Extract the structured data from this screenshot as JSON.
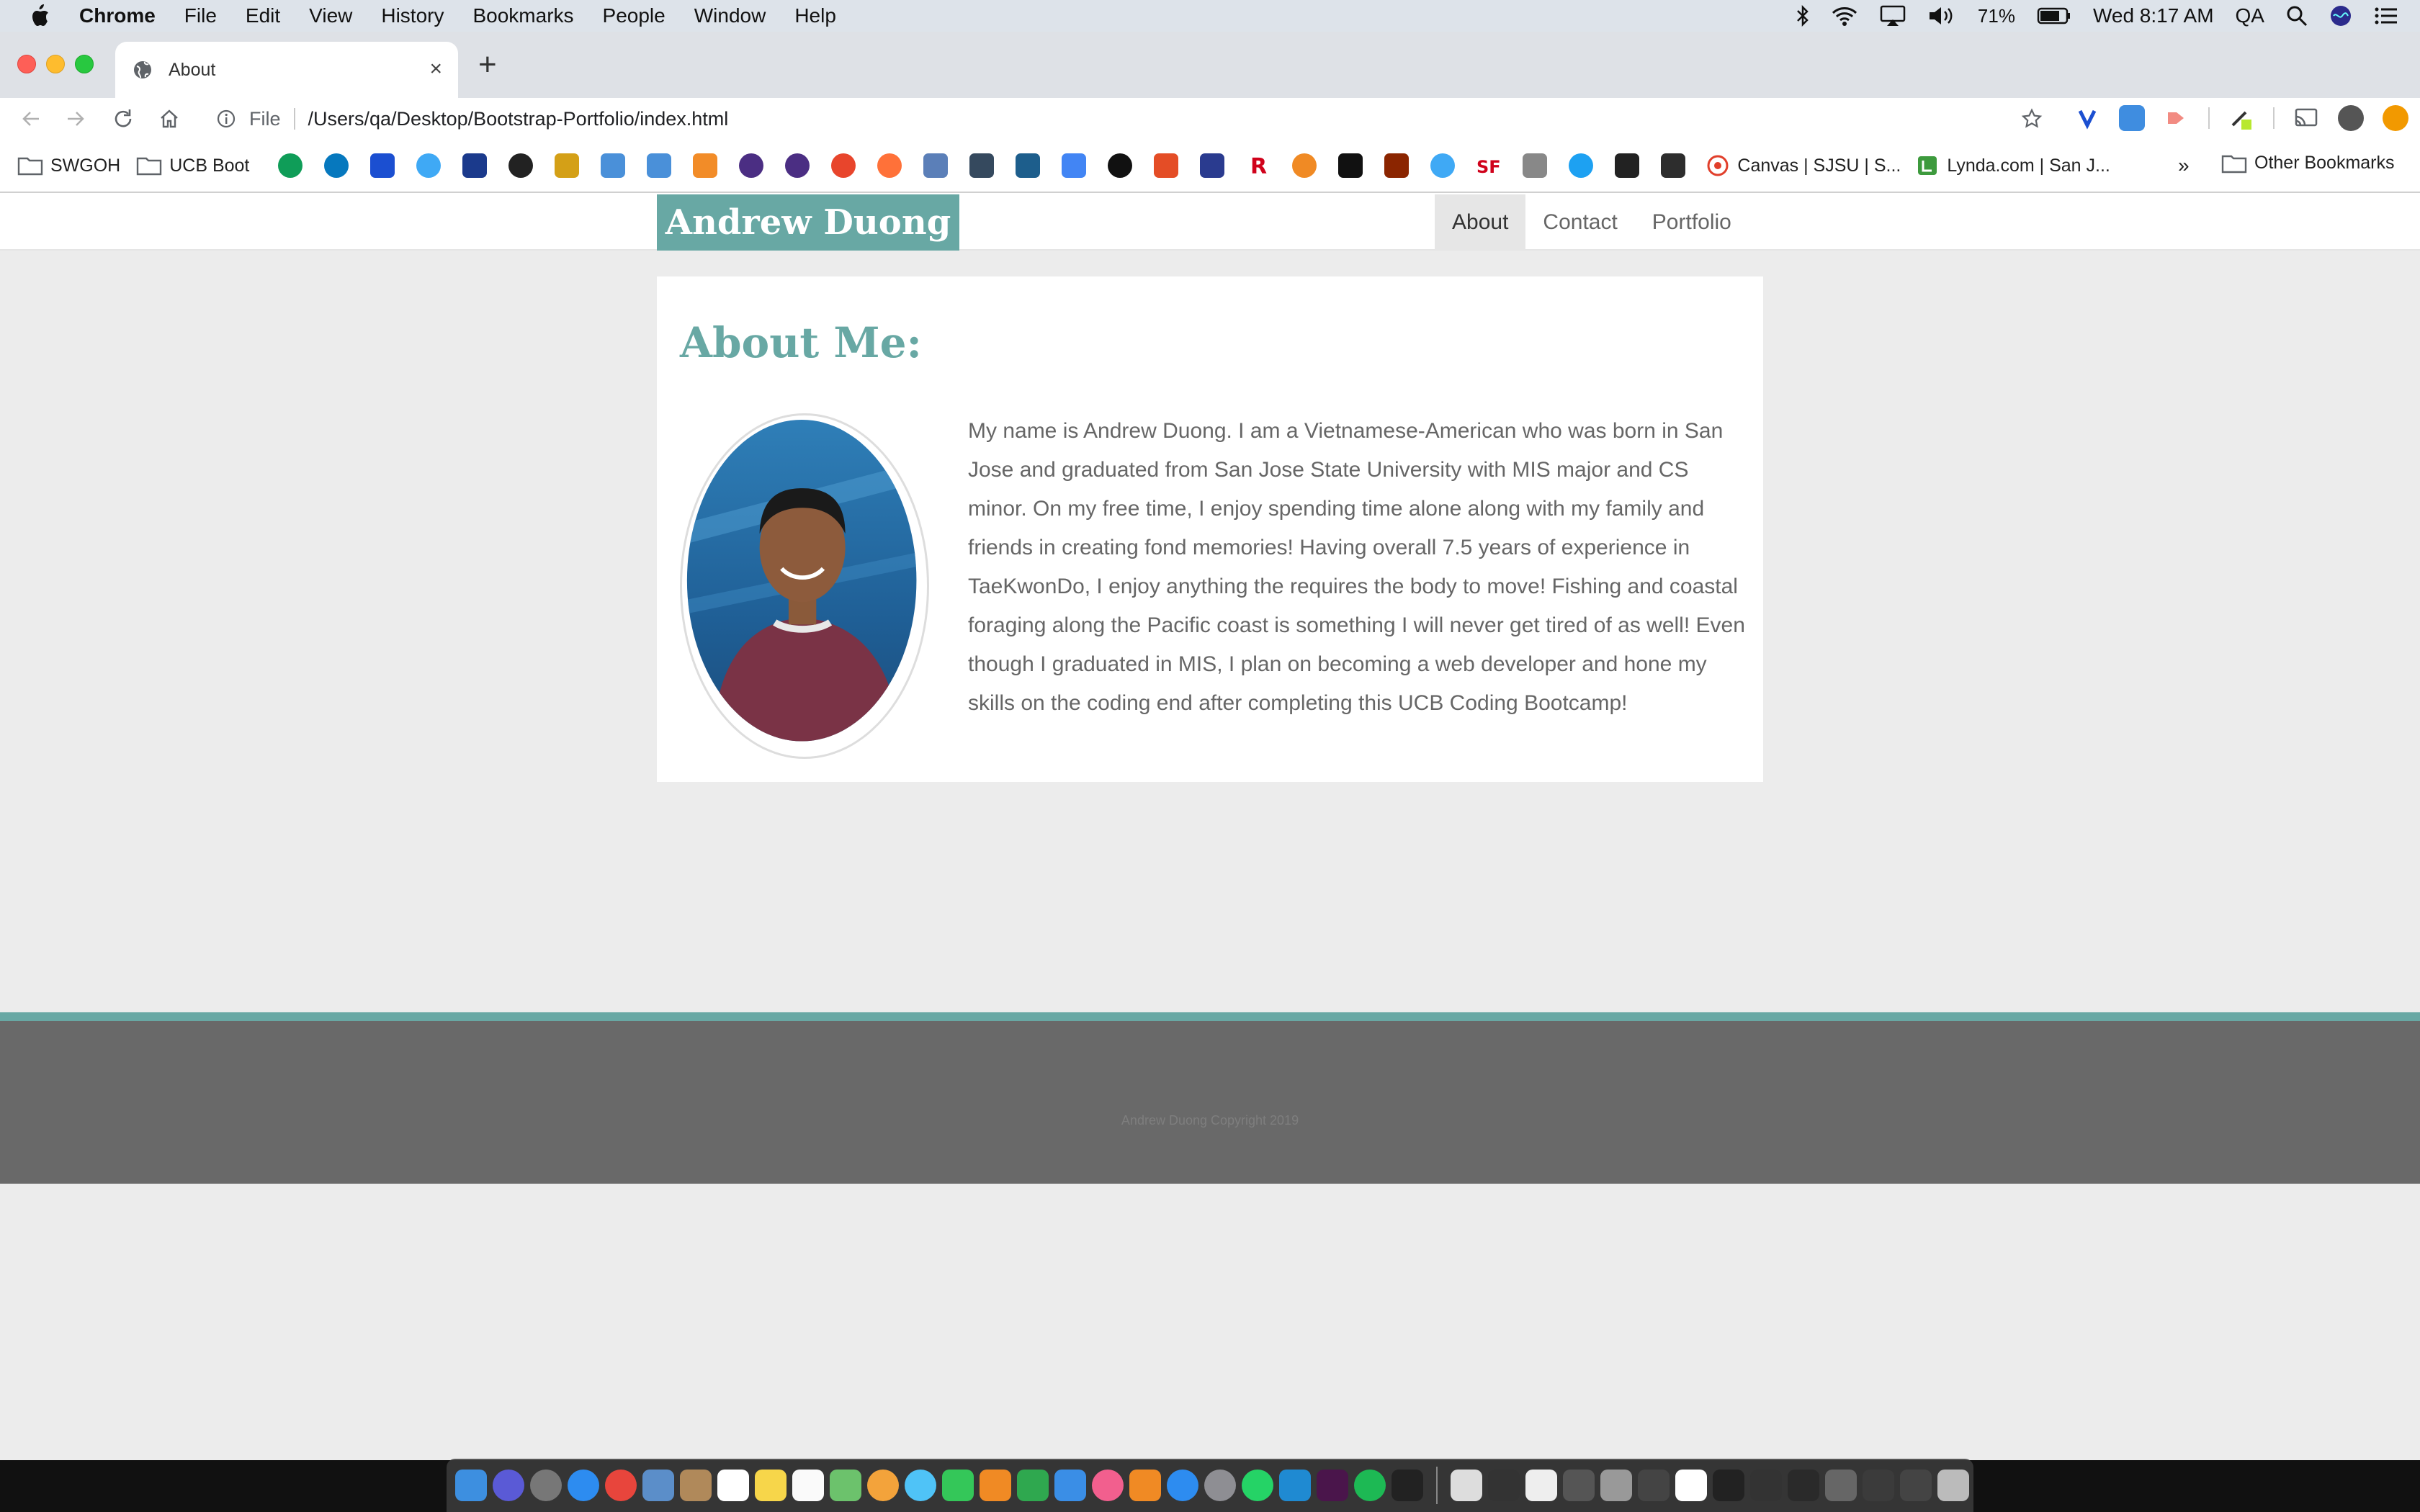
{
  "menubar": {
    "items": [
      "Chrome",
      "File",
      "Edit",
      "View",
      "History",
      "Bookmarks",
      "People",
      "Window",
      "Help"
    ],
    "battery": "71%",
    "clock": "Wed 8:17 AM",
    "user": "QA"
  },
  "tab": {
    "title": "About"
  },
  "addressbar": {
    "scheme": "File",
    "url": "/Users/qa/Desktop/Bootstrap-Portfolio/index.html"
  },
  "bookmarks": {
    "folders": [
      "SWGOH",
      "UCB Boot"
    ],
    "named": [
      "Canvas | SJSU | S...",
      "Lynda.com | San J..."
    ],
    "overflow": "»",
    "other": "Other Bookmarks"
  },
  "site": {
    "brand": "Andrew Duong",
    "nav": [
      "About",
      "Contact",
      "Portfolio"
    ],
    "heading": "About Me:",
    "bio": "My name is Andrew Duong. I am a Vietnamese-American who was born in San Jose and graduated from San Jose State University with MIS major and CS minor. On my free time, I enjoy spending time alone along with my family and friends in creating fond memories! Having overall 7.5 years of experience in TaeKwonDo, I enjoy anything the requires the body to move! Fishing and coastal foraging along the Pacific coast is something I will never get tired of as well! Even though I graduated in MIS, I plan on becoming a web developer and hone my skills on the coding end after completing this UCB Coding Bootcamp!",
    "copyright": "Andrew Duong Copyright 2019"
  },
  "colors": {
    "accent": "#68a8a4",
    "footer": "#696969",
    "page_bg": "#ececec"
  },
  "icons": [
    "apple-icon",
    "bluetooth-icon",
    "wifi-icon",
    "airplay-icon",
    "volume-icon",
    "battery-icon",
    "search-icon",
    "siri-icon",
    "control-center-icon",
    "globe-icon",
    "back-icon",
    "forward-icon",
    "reload-icon",
    "home-icon",
    "info-icon",
    "star-icon",
    "folder-icon"
  ]
}
